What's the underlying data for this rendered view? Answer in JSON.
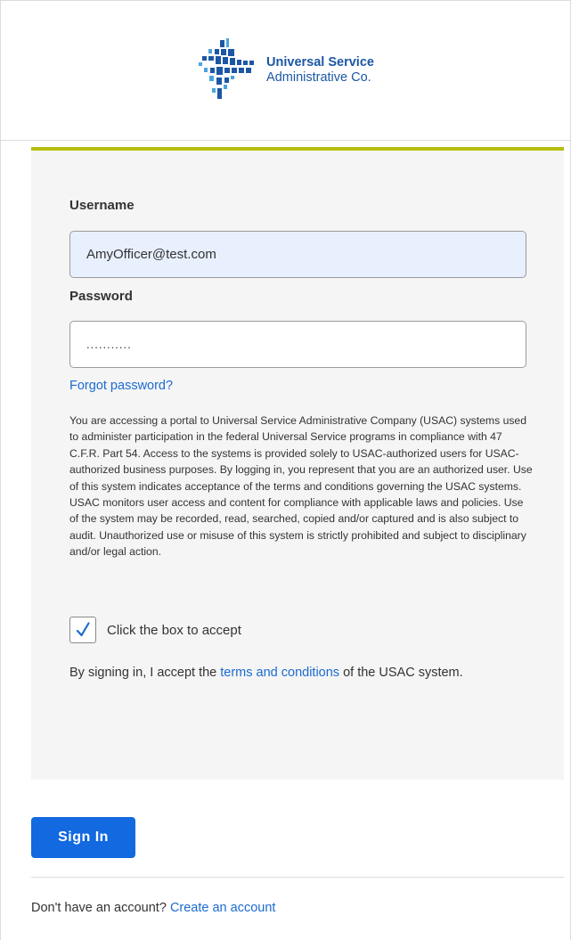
{
  "brand": {
    "name_line1": "Universal Service",
    "name_line2": "Administrative Co.",
    "color": "#1c57a4",
    "accent_color": "#b4be0f"
  },
  "form": {
    "username_label": "Username",
    "username_value": "AmyOfficer@test.com",
    "password_label": "Password",
    "password_masked": "...........",
    "forgot_password_link": "Forgot password?",
    "notice": "You are accessing a portal to Universal Service Administrative Company (USAC) systems used to administer participation in the federal Universal Service programs in compliance with 47 C.F.R. Part 54. Access to the systems is provided solely to USAC-authorized users for USAC-authorized business purposes. By logging in, you represent that you are an authorized user. Use of this system indicates acceptance of the terms and conditions governing the USAC systems. USAC monitors user access and content for compliance with applicable laws and policies. Use of the system may be recorded, read, searched, copied and/or captured and is also subject to audit. Unauthorized use or misuse of this system is strictly prohibited and subject to disciplinary and/or legal action.",
    "accept_checkbox_checked": true,
    "accept_label": "Click the box to accept",
    "consent_prefix": "By signing in, I accept the ",
    "consent_link": "terms and conditions",
    "consent_suffix": " of the USAC system."
  },
  "actions": {
    "sign_in_label": "Sign In",
    "sign_in_color": "#1269e0"
  },
  "footer": {
    "prompt": "Don't have an account? ",
    "create_account_link": "Create an account"
  },
  "icons": {
    "logo": "usac-logo-icon",
    "checkmark": "checkmark-icon"
  }
}
